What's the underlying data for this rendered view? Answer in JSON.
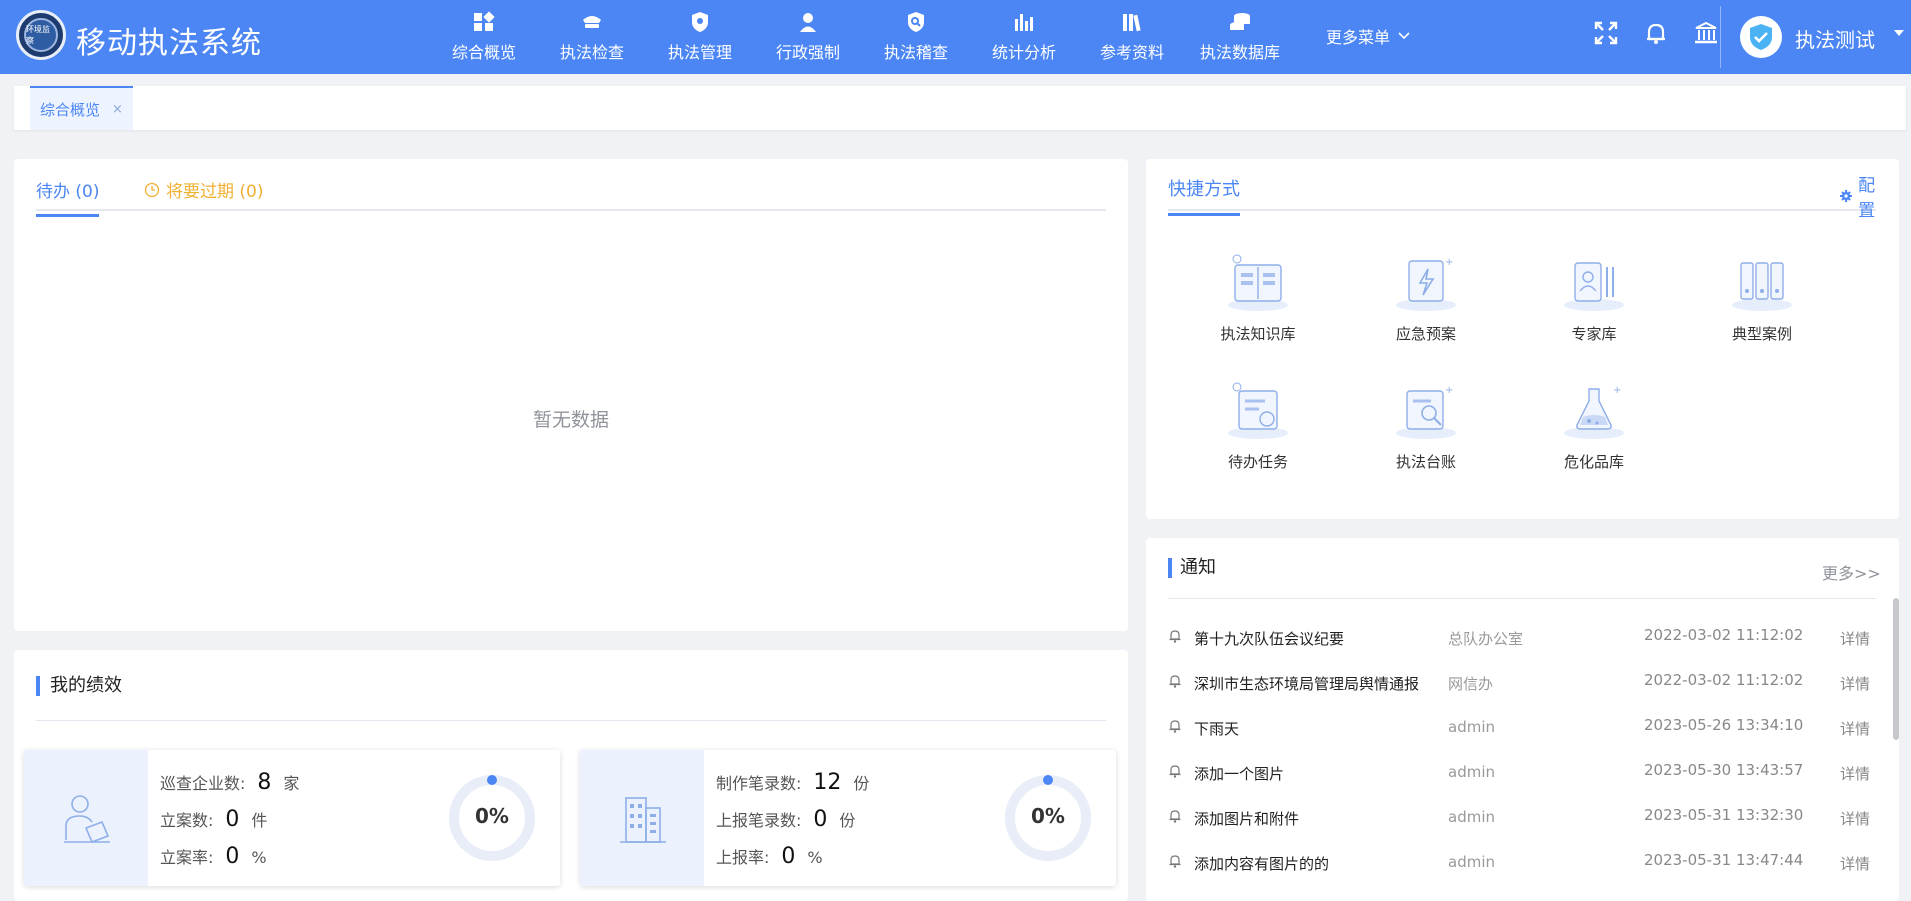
{
  "header": {
    "title": "移动执法系统",
    "logo_text": "环境监察",
    "nav": [
      {
        "label": "综合概览",
        "icon": "dashboard-icon"
      },
      {
        "label": "执法检查",
        "icon": "police-hat-icon"
      },
      {
        "label": "执法管理",
        "icon": "shield-badge-icon"
      },
      {
        "label": "行政强制",
        "icon": "officer-icon"
      },
      {
        "label": "执法稽查",
        "icon": "shield-search-icon"
      },
      {
        "label": "统计分析",
        "icon": "bar-chart-icon"
      },
      {
        "label": "参考资料",
        "icon": "books-icon"
      },
      {
        "label": "执法数据库",
        "icon": "database-icon"
      }
    ],
    "more_menu": "更多菜单",
    "user_name": "执法测试"
  },
  "tabs": [
    {
      "label": "综合概览",
      "close": "×"
    }
  ],
  "todo": {
    "tab_pending": "待办 (0)",
    "tab_expiring": "将要过期 (0)",
    "empty_text": "暂无数据"
  },
  "performance": {
    "title": "我的绩效",
    "card1": {
      "rows": [
        {
          "label": "巡查企业数:",
          "value": "8",
          "unit": "家"
        },
        {
          "label": "立案数:",
          "value": "0",
          "unit": "件"
        },
        {
          "label": "立案率:",
          "value": "0",
          "unit": "%"
        }
      ],
      "percent_label": "0%",
      "percent": 0
    },
    "card2": {
      "rows": [
        {
          "label": "制作笔录数:",
          "value": "12",
          "unit": "份"
        },
        {
          "label": "上报笔录数:",
          "value": "0",
          "unit": "份"
        },
        {
          "label": "上报率:",
          "value": "0",
          "unit": "%"
        }
      ],
      "percent_label": "0%",
      "percent": 0
    }
  },
  "quick": {
    "title": "快捷方式",
    "config_label": "配置",
    "items": [
      {
        "label": "执法知识库",
        "icon": "knowledge-base-icon"
      },
      {
        "label": "应急预案",
        "icon": "emergency-plan-icon"
      },
      {
        "label": "专家库",
        "icon": "expert-icon"
      },
      {
        "label": "典型案例",
        "icon": "case-folders-icon"
      },
      {
        "label": "待办任务",
        "icon": "todo-task-icon"
      },
      {
        "label": "执法台账",
        "icon": "ledger-icon"
      },
      {
        "label": "危化品库",
        "icon": "flask-icon"
      }
    ]
  },
  "notice": {
    "title": "通知",
    "more_label": "更多>>",
    "rows": [
      {
        "title": "第十九次队伍会议纪要",
        "dept": "总队办公室",
        "time": "2022-03-02 11:12:02",
        "detail": "详情"
      },
      {
        "title": "深圳市生态环境局管理局舆情通报",
        "dept": "网信办",
        "time": "2022-03-02 11:12:02",
        "detail": "详情"
      },
      {
        "title": "下雨天",
        "dept": "admin",
        "time": "2023-05-26 13:34:10",
        "detail": "详情"
      },
      {
        "title": "添加一个图片",
        "dept": "admin",
        "time": "2023-05-30 13:43:57",
        "detail": "详情"
      },
      {
        "title": "添加图片和附件",
        "dept": "admin",
        "time": "2023-05-31 13:32:30",
        "detail": "详情"
      },
      {
        "title": "添加内容有图片的的",
        "dept": "admin",
        "time": "2023-05-31 13:47:44",
        "detail": "详情"
      }
    ]
  },
  "colors": {
    "primary": "#4b86f4",
    "warning": "#f0b032",
    "bg": "#f0f2f5"
  }
}
